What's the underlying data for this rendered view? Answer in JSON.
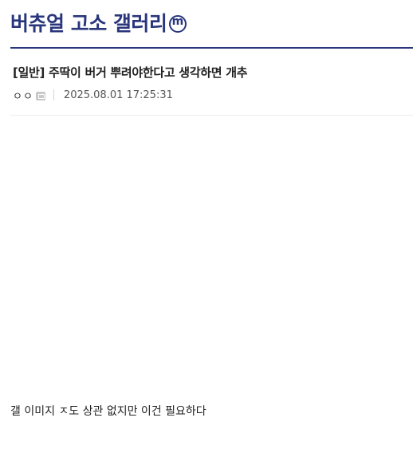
{
  "gallery": {
    "title": "버츄얼 고소 갤러리",
    "minor_badge": "m",
    "accent_color": "#29367c"
  },
  "post": {
    "title": "[일반] 주딱이 버거 뿌려야한다고 생각하면 개추",
    "author": "ㅇㅇ",
    "author_icon": "fluid-nick-icon",
    "date": "2025.08.01 17:25:31",
    "body": "갤 이미지 ㅈ도 상관 없지만 이건 필요하다"
  }
}
